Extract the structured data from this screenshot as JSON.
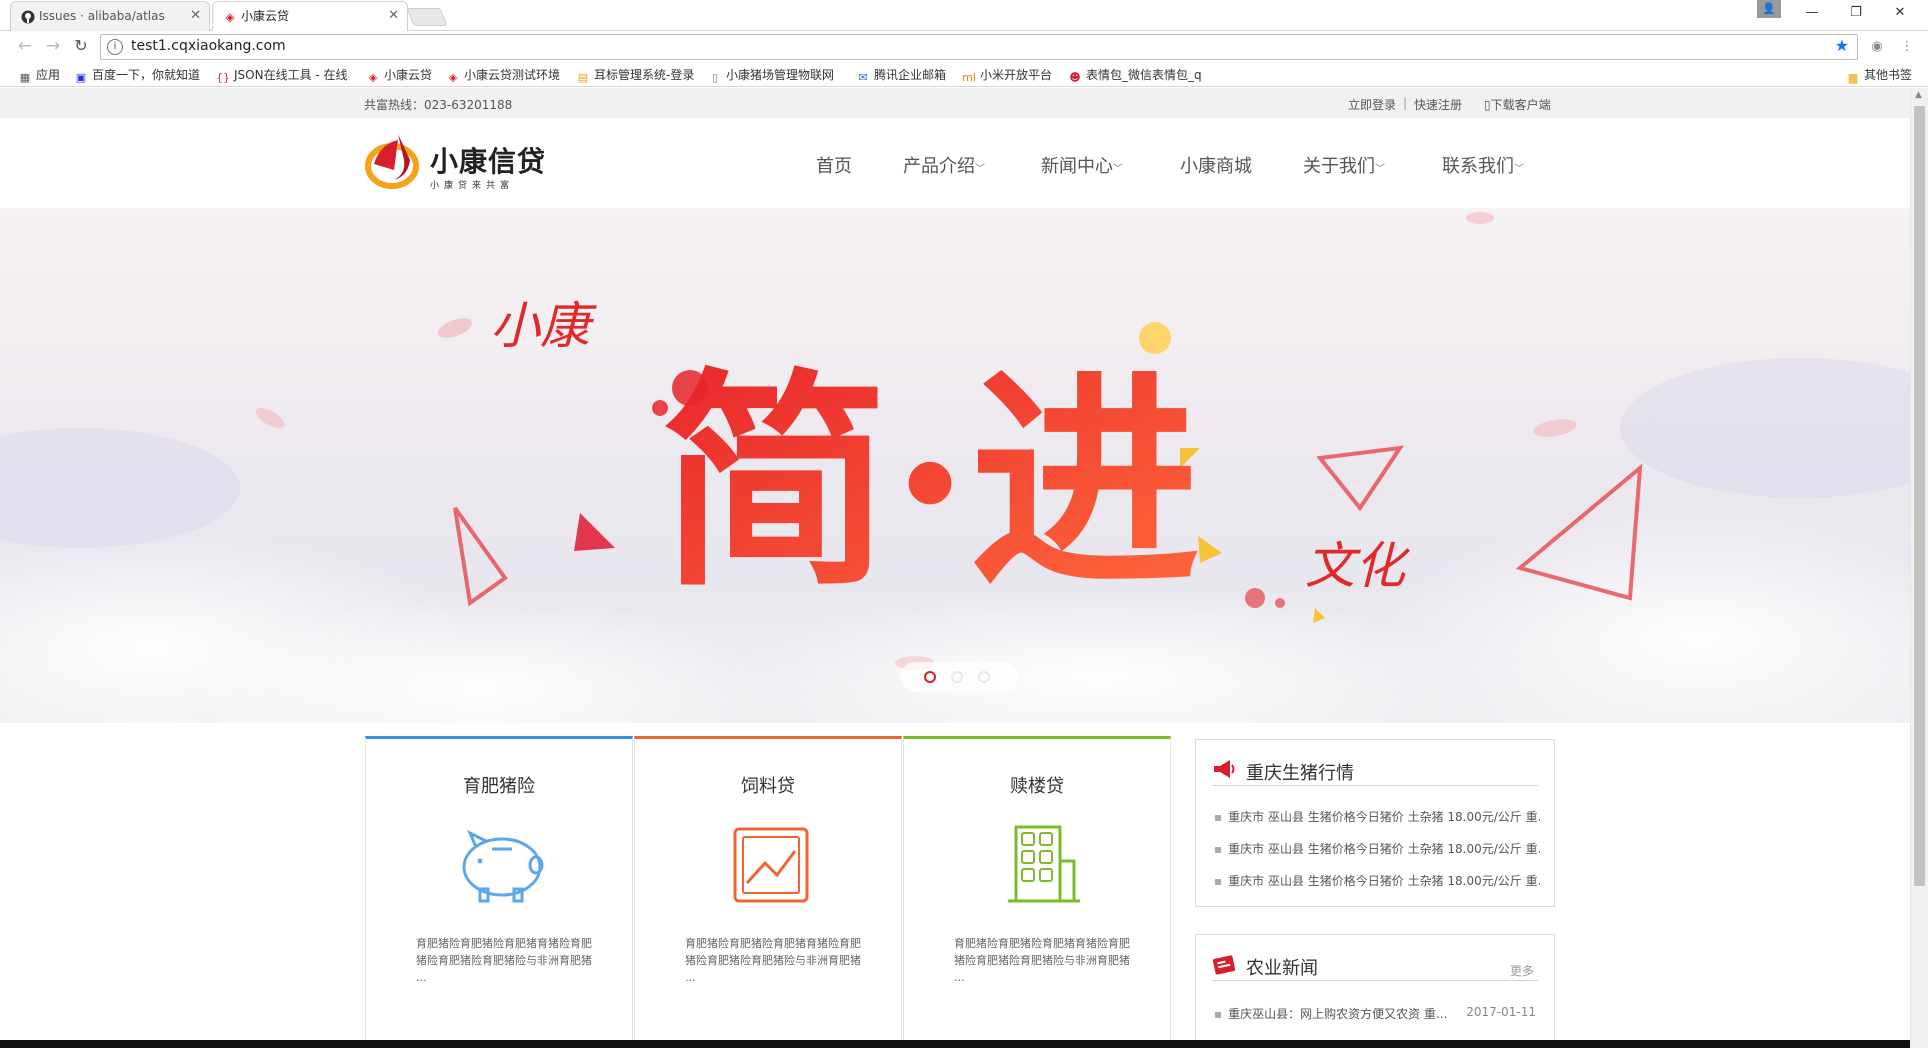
{
  "browser": {
    "tabs": [
      {
        "title": "Issues · alibaba/atlas",
        "icon": "github-icon"
      },
      {
        "title": "小康云贷",
        "icon": "xiaokang-favicon-icon"
      }
    ],
    "url": "test1.cqxiaokang.com",
    "bookmarks": [
      {
        "label": "应用"
      },
      {
        "label": "百度一下，你就知道"
      },
      {
        "label": "JSON在线工具 - 在线"
      },
      {
        "label": "小康云贷"
      },
      {
        "label": "小康云贷测试环境"
      },
      {
        "label": "耳标管理系统-登录"
      },
      {
        "label": "小康猪场管理物联网"
      },
      {
        "label": "腾讯企业邮箱"
      },
      {
        "label": "小米开放平台"
      },
      {
        "label": "表情包_微信表情包_q"
      }
    ],
    "other_bookmarks": "其他书签"
  },
  "topbar": {
    "hotline": "共富热线：023-63201188",
    "login": "立即登录",
    "separator": "|",
    "register": "快速注册",
    "download": "下载客户端"
  },
  "logo": {
    "brand": "小康信贷",
    "slogan": "小康贷来共富"
  },
  "nav": [
    {
      "label": "首页",
      "dropdown": false
    },
    {
      "label": "产品介绍",
      "dropdown": true
    },
    {
      "label": "新闻中心",
      "dropdown": true
    },
    {
      "label": "小康商城",
      "dropdown": false
    },
    {
      "label": "关于我们",
      "dropdown": true
    },
    {
      "label": "联系我们",
      "dropdown": true
    }
  ],
  "banner": {
    "top_text": "小康",
    "big_text": "简·进",
    "bottom_text": "文化",
    "slides": 3,
    "active_slide": 1
  },
  "products": [
    {
      "title": "育肥猪险",
      "desc": "育肥猪险育肥猪险育肥猪育猪险育肥猪险育肥猪险育肥猪险与非洲育肥猪 ...",
      "accent": "#3a8ee6",
      "icon": "piggy-bank-icon"
    },
    {
      "title": "饲料贷",
      "desc": "育肥猪险育肥猪险育肥猪育猪险育肥猪险育肥猪险育肥猪险与非洲育肥猪 ...",
      "accent": "#f0652f",
      "icon": "trend-chart-icon"
    },
    {
      "title": "赎楼贷",
      "desc": "育肥猪险育肥猪险育肥猪育猪险育肥猪险育肥猪险育肥猪险与非洲育肥猪 ...",
      "accent": "#7dbb2a",
      "icon": "building-icon"
    }
  ],
  "pig_market": {
    "title": "重庆生猪行情",
    "items": [
      "重庆市 巫山县 生猪价格今日猪价 土杂猪 18.00元/公斤 重...",
      "重庆市 巫山县 生猪价格今日猪价 土杂猪 18.00元/公斤 重...",
      "重庆市 巫山县 生猪价格今日猪价 土杂猪 18.00元/公斤 重..."
    ]
  },
  "agri_news": {
    "title": "农业新闻",
    "more": "更多",
    "items": [
      {
        "text": "重庆巫山县：网上购农资方便又农资 重...",
        "date": "2017-01-11"
      }
    ]
  }
}
